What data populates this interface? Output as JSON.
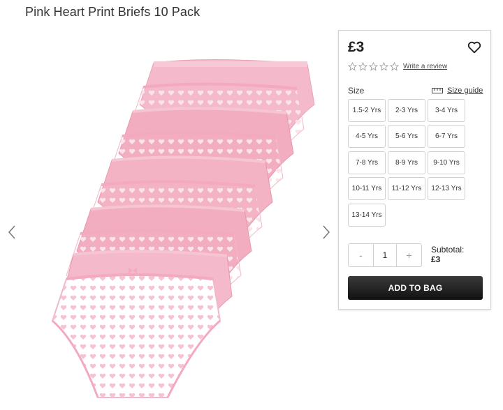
{
  "product": {
    "title": "Pink Heart Print Briefs 10 Pack",
    "price": "£3",
    "review_link": "Write a review",
    "rating_icon": "star-outline-icon"
  },
  "size": {
    "label": "Size",
    "guide_label": "Size guide",
    "options": [
      "1.5-2 Yrs",
      "2-3 Yrs",
      "3-4 Yrs",
      "4-5 Yrs",
      "5-6 Yrs",
      "6-7 Yrs",
      "7-8 Yrs",
      "8-9 Yrs",
      "9-10 Yrs",
      "10-11 Yrs",
      "11-12 Yrs",
      "12-13 Yrs",
      "13-14 Yrs"
    ]
  },
  "quantity": {
    "minus": "-",
    "value": "1",
    "plus": "+"
  },
  "subtotal": {
    "label": "Subtotal:",
    "amount": "£3"
  },
  "cta": {
    "add_to_bag": "ADD TO BAG"
  },
  "colors": {
    "pink": "#f3b6c8",
    "pink_light": "#f9d6e1",
    "white": "#ffffff",
    "button_dark": "#1a1a1a"
  }
}
